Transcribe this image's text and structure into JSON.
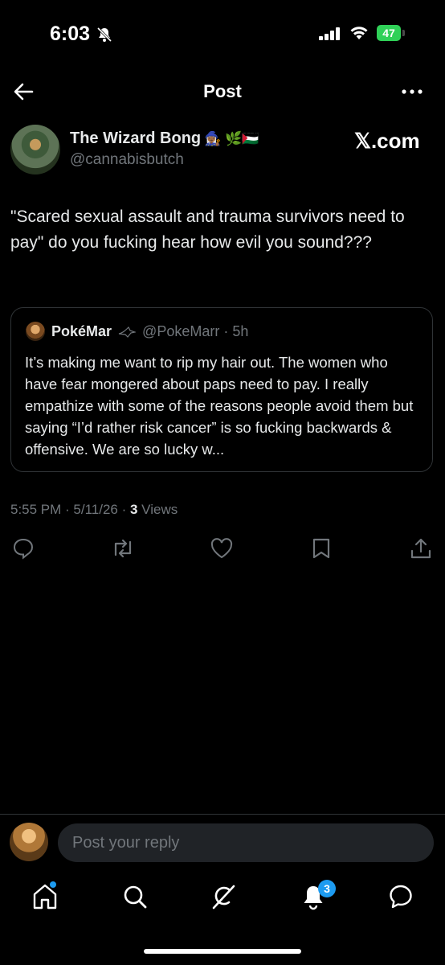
{
  "status_bar": {
    "time": "6:03",
    "battery": "47"
  },
  "header": {
    "title": "Post"
  },
  "author": {
    "name": "The Wizard Bong",
    "name_emojis": "🧙🏾‍♀️ 🌿🇵🇸",
    "handle": "@cannabisbutch",
    "source": "𝕏.com"
  },
  "post": {
    "text": "\"Scared sexual assault and trauma survivors need to pay\" do you fucking hear how evil you sound???"
  },
  "quote": {
    "name": "PokéMar",
    "handle_time": "@PokeMarr · 5h",
    "text": "It’s making me want to rip my hair out. The women who have fear mongered about paps need to pay. I really empathize with some of the reasons people avoid them but saying “I’d rather risk cancer” is so fucking backwards & offensive. We are so lucky w..."
  },
  "meta": {
    "time_date": "5:55 PM · 5/11/26 · ",
    "views_count": "3",
    "views_label": " Views"
  },
  "reply": {
    "placeholder": "Post your reply"
  },
  "nav": {
    "notifications_badge": "3"
  },
  "colors": {
    "accent": "#1d9bf0",
    "muted": "#71767b",
    "battery": "#30d158"
  },
  "icons": [
    "back-arrow-icon",
    "more-icon",
    "reply-icon",
    "repost-icon",
    "like-icon",
    "bookmark-icon",
    "share-icon",
    "home-icon",
    "search-icon",
    "grok-icon",
    "notifications-icon",
    "messages-icon"
  ]
}
